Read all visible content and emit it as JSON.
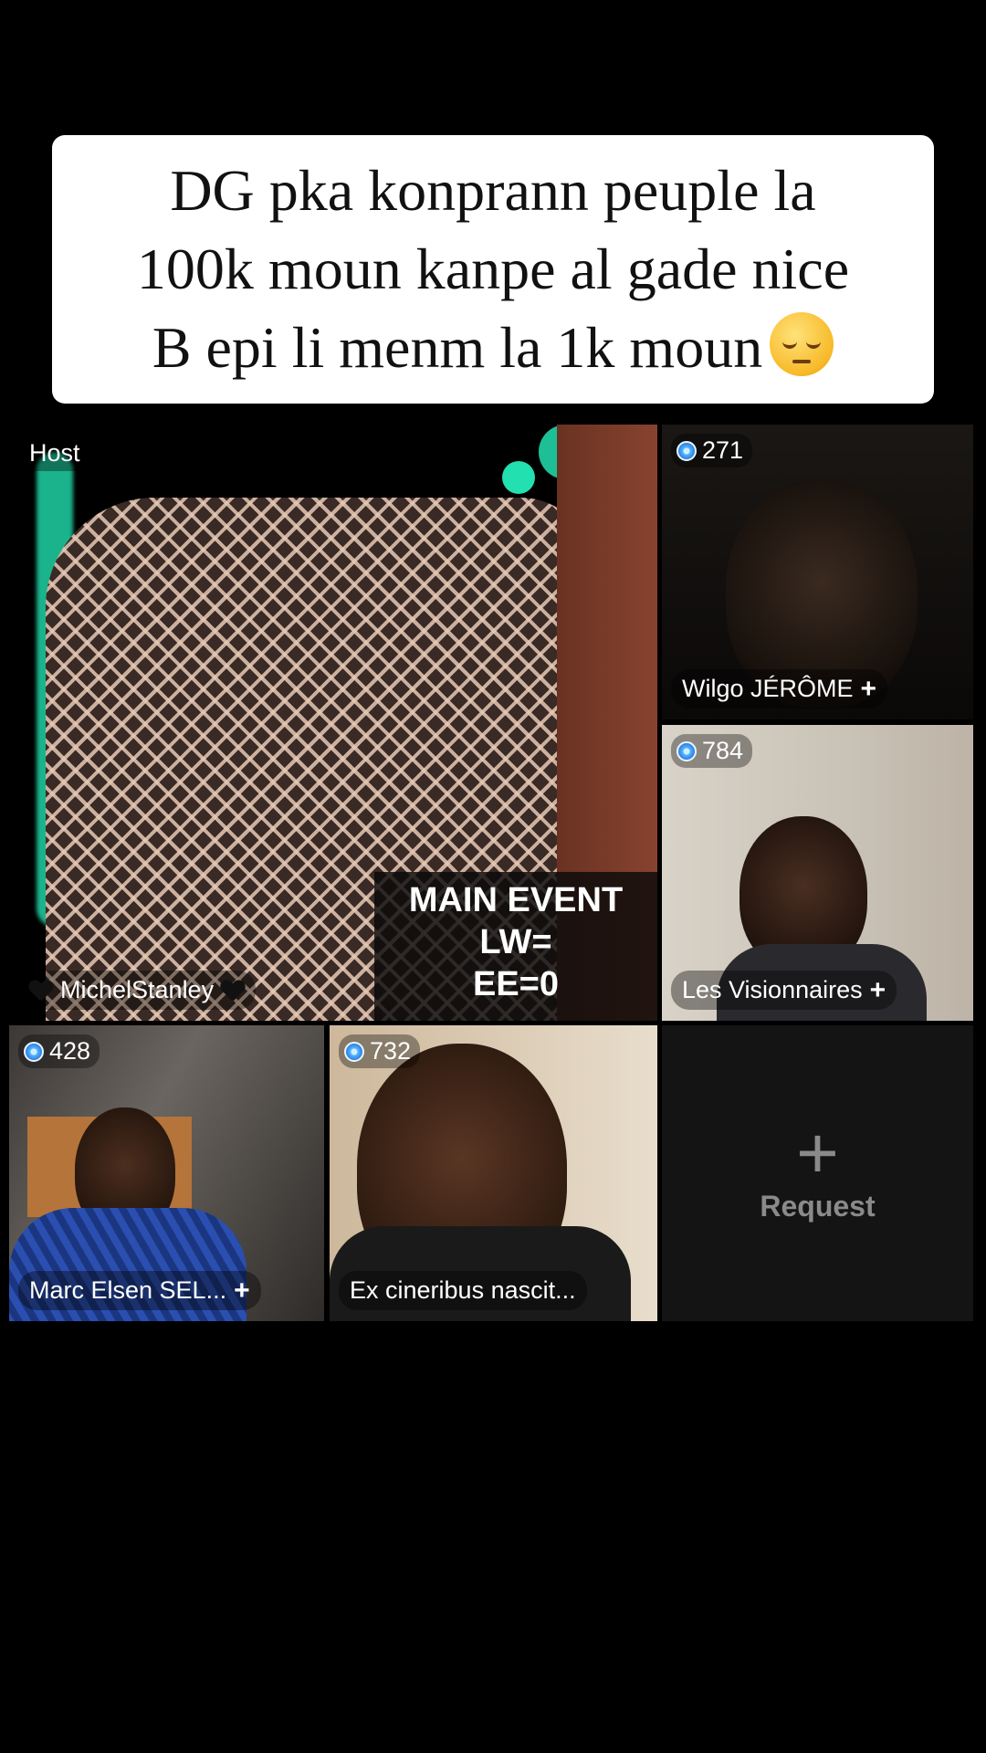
{
  "caption": {
    "line1": "DG pka konprann peuple la",
    "line2": "100k moun kanpe al gade nice",
    "line3": "B epi li menm la 1k moun",
    "emoji": "pensive-face-emoji"
  },
  "host": {
    "badge": "Host",
    "name": "MichelStanley",
    "banner": {
      "line1": "MAIN EVENT",
      "line2": "LW=",
      "line3": "EE=0"
    }
  },
  "guests": [
    {
      "score": "271",
      "name": "Wilgo JÉRÔME",
      "plus": "+"
    },
    {
      "score": "784",
      "name": "Les Visionnaires",
      "plus": "+"
    },
    {
      "score": "428",
      "name": "Marc Elsen SEL...",
      "plus": "+"
    },
    {
      "score": "732",
      "name": "Ex cineribus nascit..."
    }
  ],
  "request": {
    "icon": "plus-icon",
    "label": "Request",
    "plus": "+"
  },
  "colors": {
    "accent_glow": "#22e0b0",
    "gem_blue": "#2d7fe0",
    "background": "#000000"
  }
}
